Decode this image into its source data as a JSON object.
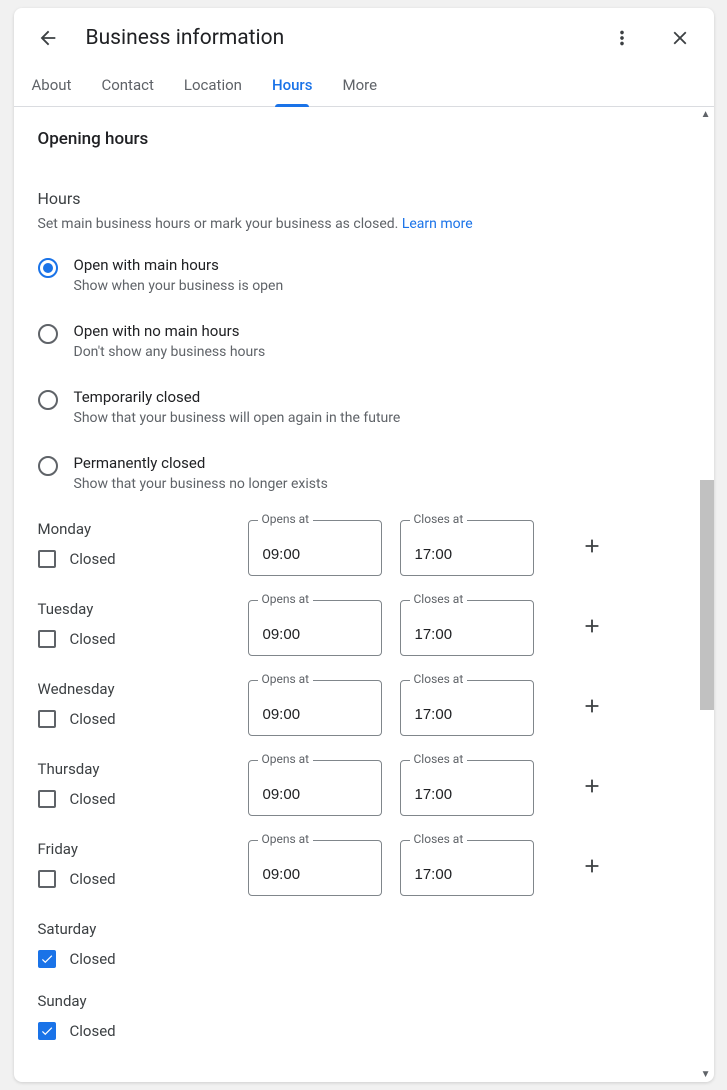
{
  "header": {
    "title": "Business information"
  },
  "tabs": [
    {
      "label": "About",
      "active": false
    },
    {
      "label": "Contact",
      "active": false
    },
    {
      "label": "Location",
      "active": false
    },
    {
      "label": "Hours",
      "active": true
    },
    {
      "label": "More",
      "active": false
    }
  ],
  "section": {
    "title": "Opening hours",
    "sub_title": "Hours",
    "sub_desc": "Set main business hours or mark your business as closed. ",
    "learn_more": "Learn more"
  },
  "radio_options": [
    {
      "label": "Open with main hours",
      "desc": "Show when your business is open",
      "selected": true
    },
    {
      "label": "Open with no main hours",
      "desc": "Don't show any business hours",
      "selected": false
    },
    {
      "label": "Temporarily closed",
      "desc": "Show that your business will open again in the future",
      "selected": false
    },
    {
      "label": "Permanently closed",
      "desc": "Show that your business no longer exists",
      "selected": false
    }
  ],
  "closed_label": "Closed",
  "opens_label": "Opens at",
  "closes_label": "Closes at",
  "days": [
    {
      "name": "Monday",
      "closed": false,
      "opens": "09:00",
      "closes": "17:00"
    },
    {
      "name": "Tuesday",
      "closed": false,
      "opens": "09:00",
      "closes": "17:00"
    },
    {
      "name": "Wednesday",
      "closed": false,
      "opens": "09:00",
      "closes": "17:00"
    },
    {
      "name": "Thursday",
      "closed": false,
      "opens": "09:00",
      "closes": "17:00"
    },
    {
      "name": "Friday",
      "closed": false,
      "opens": "09:00",
      "closes": "17:00"
    },
    {
      "name": "Saturday",
      "closed": true
    },
    {
      "name": "Sunday",
      "closed": true
    }
  ]
}
